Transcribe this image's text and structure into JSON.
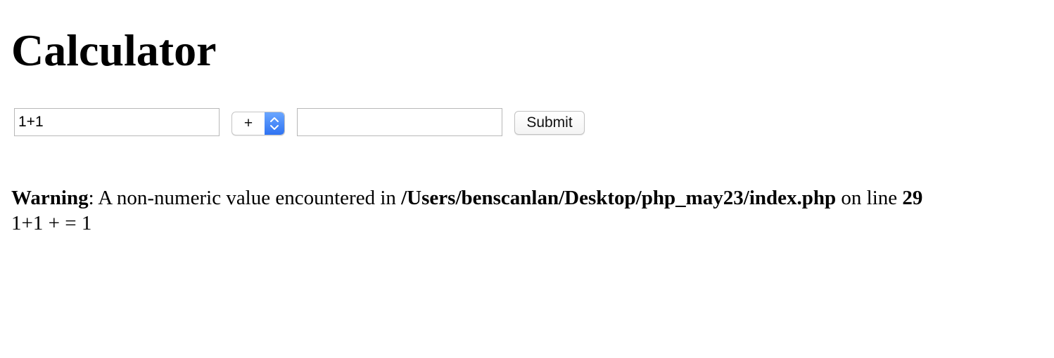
{
  "page": {
    "title": "Calculator"
  },
  "form": {
    "first_value": "1+1",
    "operator": "+",
    "second_value": "",
    "submit_label": "Submit"
  },
  "warning": {
    "label": "Warning",
    "message_prefix": ": A non-numeric value encountered in ",
    "file_path": "/Users/benscanlan/Desktop/php_may23/index.php",
    "line_text": " on line ",
    "line_number": "29"
  },
  "result": {
    "text": "1+1 + = 1"
  },
  "colors": {
    "select_accent": "#2f73f2"
  }
}
